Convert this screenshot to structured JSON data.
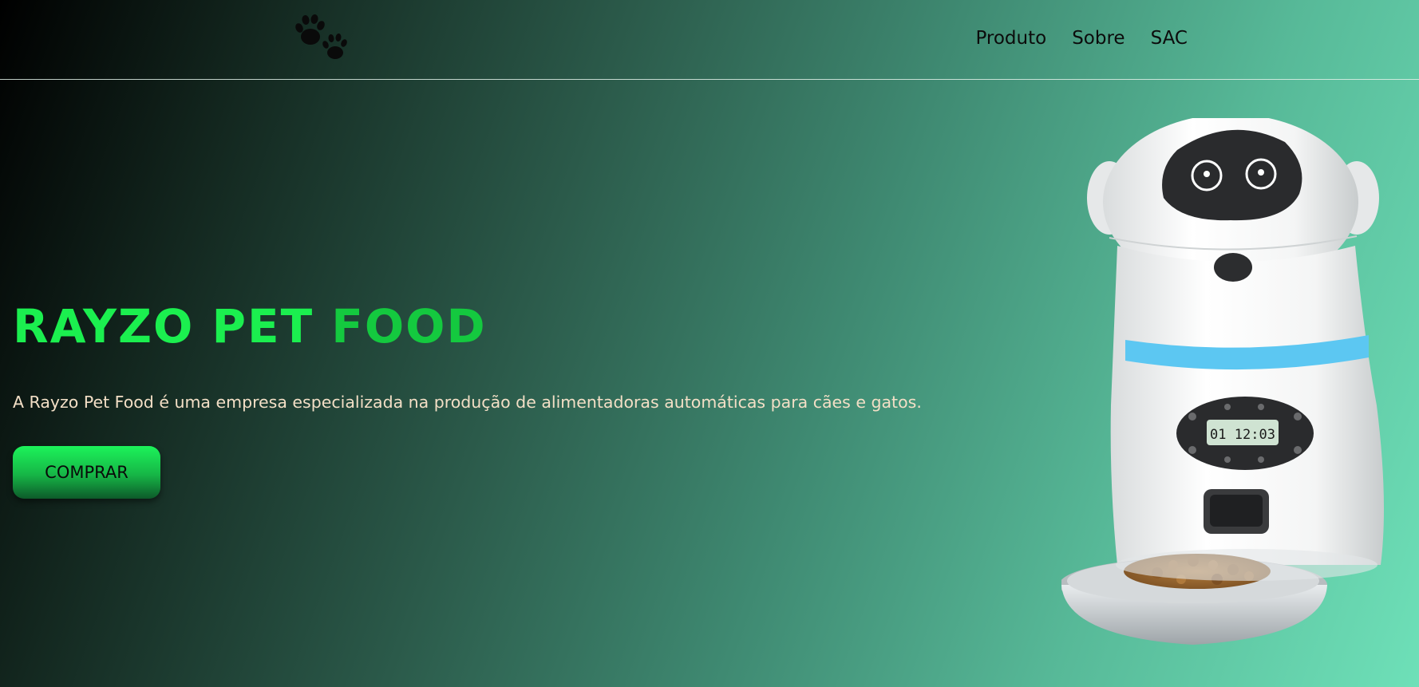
{
  "header": {
    "logo_icon": "paw-prints-icon",
    "nav": [
      {
        "label": "Produto"
      },
      {
        "label": "Sobre"
      },
      {
        "label": "SAC"
      }
    ]
  },
  "hero": {
    "title_part1": "RAYZO PET",
    "title_part2": "FOOD",
    "description": "A Rayzo Pet Food é uma empresa especializada na produção de alimentadoras automáticas para cães e gatos.",
    "buy_label": "COMPRAR",
    "product_image": "automatic-pet-feeder-robot",
    "display_time": "01 12:03"
  },
  "colors": {
    "title_bright": "#1bef4f",
    "title_dark": "#14c93f",
    "description": "#f3dfc6",
    "accent_ring": "#5cc7f2",
    "gradient_start": "#000000",
    "gradient_end": "#6ee0b8"
  }
}
